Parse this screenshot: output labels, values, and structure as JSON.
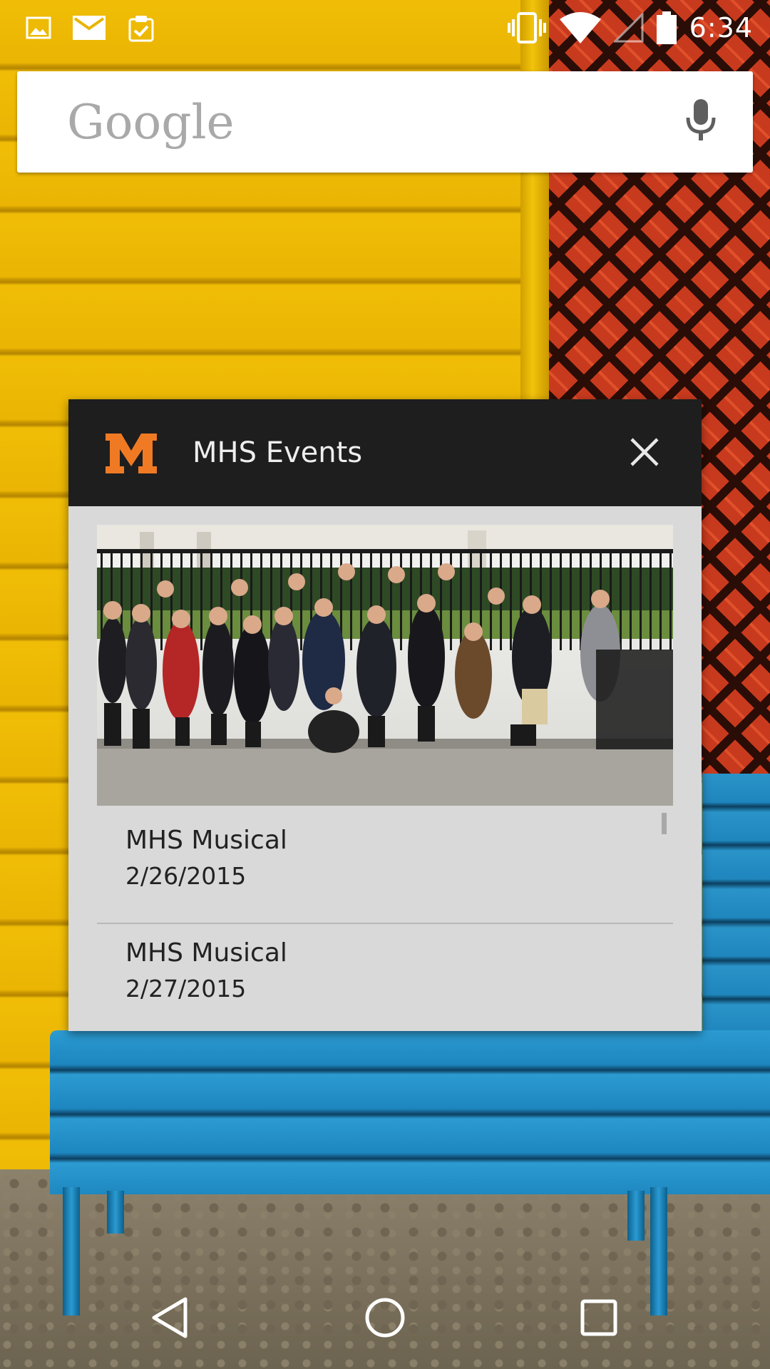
{
  "status_bar": {
    "time": "6:34",
    "left_icons": [
      "image-icon",
      "mail-icon",
      "clipboard-check-icon"
    ],
    "right_icons": [
      "vibrate-icon",
      "wifi-icon",
      "signal-icon",
      "battery-icon"
    ]
  },
  "search": {
    "logo_text": "Google",
    "mic_icon": "microphone-icon"
  },
  "widget": {
    "title": "MHS Events",
    "logo_letter": "M",
    "logo_color": "#f07a24",
    "close_icon": "close-icon",
    "photo": "group-photo",
    "events": [
      {
        "name": "MHS Musical",
        "date": "2/26/2015"
      },
      {
        "name": "MHS Musical",
        "date": "2/27/2015"
      }
    ]
  },
  "nav_bar": {
    "buttons": [
      "back-icon",
      "home-icon",
      "recents-icon"
    ]
  }
}
